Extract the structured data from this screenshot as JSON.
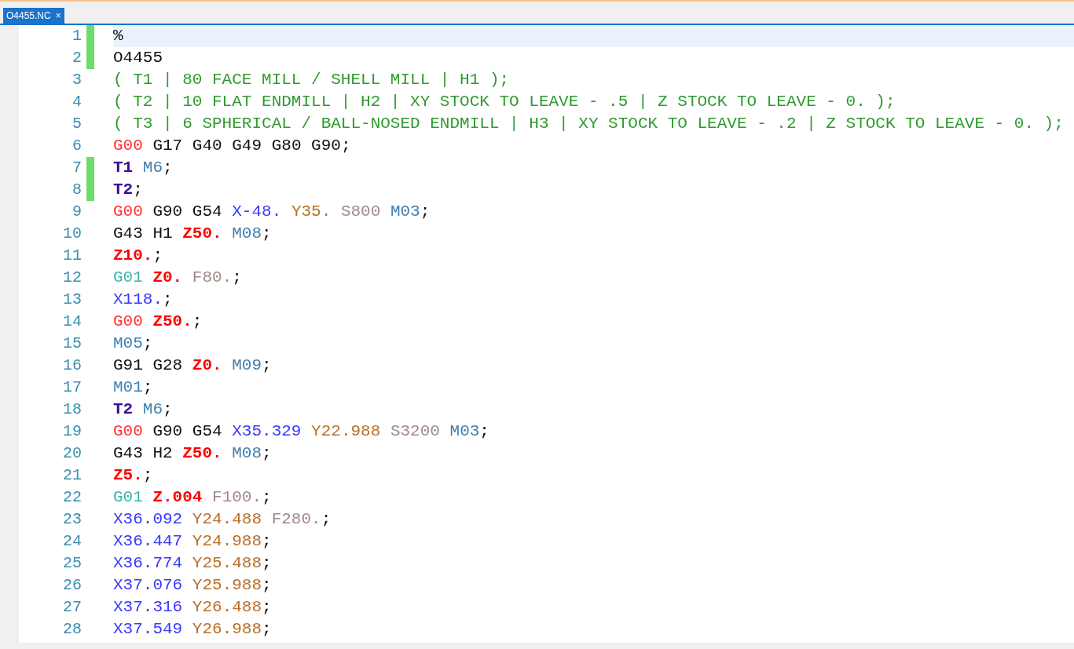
{
  "tabs": [
    {
      "label": "O4455.NC",
      "close": "×",
      "selected": true
    }
  ],
  "lines": [
    {
      "number": "1",
      "changed": true,
      "current": true,
      "tokens": [
        {
          "kind": "plain",
          "text": "%"
        }
      ]
    },
    {
      "number": "2",
      "changed": true,
      "current": false,
      "tokens": [
        {
          "kind": "plain",
          "text": "O4455"
        }
      ]
    },
    {
      "number": "3",
      "changed": false,
      "current": false,
      "tokens": [
        {
          "kind": "comment",
          "text": "( T1 | 80 FACE MILL / SHELL MILL | H1 );"
        }
      ]
    },
    {
      "number": "4",
      "changed": false,
      "current": false,
      "tokens": [
        {
          "kind": "comment",
          "text": "( T2 | 10 FLAT ENDMILL | H2 | XY STOCK TO LEAVE - .5 | Z STOCK TO LEAVE - 0. );"
        }
      ]
    },
    {
      "number": "5",
      "changed": false,
      "current": false,
      "tokens": [
        {
          "kind": "comment",
          "text": "( T3 | 6 SPHERICAL / BALL-NOSED ENDMILL | H3 | XY STOCK TO LEAVE - .2 | Z STOCK TO LEAVE - 0. );"
        }
      ]
    },
    {
      "number": "6",
      "changed": false,
      "current": false,
      "tokens": [
        {
          "kind": "rapid",
          "text": "G00"
        },
        {
          "kind": "plain",
          "text": "G17"
        },
        {
          "kind": "plain",
          "text": "G40"
        },
        {
          "kind": "plain",
          "text": "G49"
        },
        {
          "kind": "plain",
          "text": "G80"
        },
        {
          "kind": "plain",
          "text": "G90"
        },
        {
          "kind": "punct",
          "text": ";"
        }
      ]
    },
    {
      "number": "7",
      "changed": true,
      "current": false,
      "tokens": [
        {
          "kind": "tool",
          "text": "T1"
        },
        {
          "kind": "mcode",
          "text": "M6"
        },
        {
          "kind": "punct",
          "text": ";"
        }
      ]
    },
    {
      "number": "8",
      "changed": true,
      "current": false,
      "tokens": [
        {
          "kind": "tool",
          "text": "T2"
        },
        {
          "kind": "punct",
          "text": ";"
        }
      ]
    },
    {
      "number": "9",
      "changed": false,
      "current": false,
      "tokens": [
        {
          "kind": "rapid",
          "text": "G00"
        },
        {
          "kind": "plain",
          "text": "G90"
        },
        {
          "kind": "plain",
          "text": "G54"
        },
        {
          "kind": "x",
          "text": "X-48."
        },
        {
          "kind": "y",
          "text": "Y35."
        },
        {
          "kind": "speed",
          "text": "S800"
        },
        {
          "kind": "mcode",
          "text": "M03"
        },
        {
          "kind": "punct",
          "text": ";"
        }
      ]
    },
    {
      "number": "10",
      "changed": false,
      "current": false,
      "tokens": [
        {
          "kind": "plain",
          "text": "G43"
        },
        {
          "kind": "plain",
          "text": "H1"
        },
        {
          "kind": "z",
          "text": "Z50."
        },
        {
          "kind": "mcode",
          "text": "M08"
        },
        {
          "kind": "punct",
          "text": ";"
        }
      ]
    },
    {
      "number": "11",
      "changed": false,
      "current": false,
      "tokens": [
        {
          "kind": "z",
          "text": "Z10."
        },
        {
          "kind": "punct",
          "text": ";"
        }
      ]
    },
    {
      "number": "12",
      "changed": false,
      "current": false,
      "tokens": [
        {
          "kind": "linear",
          "text": "G01"
        },
        {
          "kind": "z",
          "text": "Z0."
        },
        {
          "kind": "feed",
          "text": "F80."
        },
        {
          "kind": "punct",
          "text": ";"
        }
      ]
    },
    {
      "number": "13",
      "changed": false,
      "current": false,
      "tokens": [
        {
          "kind": "x",
          "text": "X118."
        },
        {
          "kind": "punct",
          "text": ";"
        }
      ]
    },
    {
      "number": "14",
      "changed": false,
      "current": false,
      "tokens": [
        {
          "kind": "rapid",
          "text": "G00"
        },
        {
          "kind": "z",
          "text": "Z50."
        },
        {
          "kind": "punct",
          "text": ";"
        }
      ]
    },
    {
      "number": "15",
      "changed": false,
      "current": false,
      "tokens": [
        {
          "kind": "mcode",
          "text": "M05"
        },
        {
          "kind": "punct",
          "text": ";"
        }
      ]
    },
    {
      "number": "16",
      "changed": false,
      "current": false,
      "tokens": [
        {
          "kind": "plain",
          "text": "G91"
        },
        {
          "kind": "plain",
          "text": "G28"
        },
        {
          "kind": "z",
          "text": "Z0."
        },
        {
          "kind": "mcode",
          "text": "M09"
        },
        {
          "kind": "punct",
          "text": ";"
        }
      ]
    },
    {
      "number": "17",
      "changed": false,
      "current": false,
      "tokens": [
        {
          "kind": "mcode",
          "text": "M01"
        },
        {
          "kind": "punct",
          "text": ";"
        }
      ]
    },
    {
      "number": "18",
      "changed": false,
      "current": false,
      "tokens": [
        {
          "kind": "tool",
          "text": "T2"
        },
        {
          "kind": "mcode",
          "text": "M6"
        },
        {
          "kind": "punct",
          "text": ";"
        }
      ]
    },
    {
      "number": "19",
      "changed": false,
      "current": false,
      "tokens": [
        {
          "kind": "rapid",
          "text": "G00"
        },
        {
          "kind": "plain",
          "text": "G90"
        },
        {
          "kind": "plain",
          "text": "G54"
        },
        {
          "kind": "x",
          "text": "X35.329"
        },
        {
          "kind": "y",
          "text": "Y22.988"
        },
        {
          "kind": "speed",
          "text": "S3200"
        },
        {
          "kind": "mcode",
          "text": "M03"
        },
        {
          "kind": "punct",
          "text": ";"
        }
      ]
    },
    {
      "number": "20",
      "changed": false,
      "current": false,
      "tokens": [
        {
          "kind": "plain",
          "text": "G43"
        },
        {
          "kind": "plain",
          "text": "H2"
        },
        {
          "kind": "z",
          "text": "Z50."
        },
        {
          "kind": "mcode",
          "text": "M08"
        },
        {
          "kind": "punct",
          "text": ";"
        }
      ]
    },
    {
      "number": "21",
      "changed": false,
      "current": false,
      "tokens": [
        {
          "kind": "z",
          "text": "Z5."
        },
        {
          "kind": "punct",
          "text": ";"
        }
      ]
    },
    {
      "number": "22",
      "changed": false,
      "current": false,
      "tokens": [
        {
          "kind": "linear",
          "text": "G01"
        },
        {
          "kind": "z",
          "text": "Z.004"
        },
        {
          "kind": "feed",
          "text": "F100."
        },
        {
          "kind": "punct",
          "text": ";"
        }
      ]
    },
    {
      "number": "23",
      "changed": false,
      "current": false,
      "tokens": [
        {
          "kind": "x",
          "text": "X36.092"
        },
        {
          "kind": "y",
          "text": "Y24.488"
        },
        {
          "kind": "feed",
          "text": "F280."
        },
        {
          "kind": "punct",
          "text": ";"
        }
      ]
    },
    {
      "number": "24",
      "changed": false,
      "current": false,
      "tokens": [
        {
          "kind": "x",
          "text": "X36.447"
        },
        {
          "kind": "y",
          "text": "Y24.988"
        },
        {
          "kind": "punct",
          "text": ";"
        }
      ]
    },
    {
      "number": "25",
      "changed": false,
      "current": false,
      "tokens": [
        {
          "kind": "x",
          "text": "X36.774"
        },
        {
          "kind": "y",
          "text": "Y25.488"
        },
        {
          "kind": "punct",
          "text": ";"
        }
      ]
    },
    {
      "number": "26",
      "changed": false,
      "current": false,
      "tokens": [
        {
          "kind": "x",
          "text": "X37.076"
        },
        {
          "kind": "y",
          "text": "Y25.988"
        },
        {
          "kind": "punct",
          "text": ";"
        }
      ]
    },
    {
      "number": "27",
      "changed": false,
      "current": false,
      "tokens": [
        {
          "kind": "x",
          "text": "X37.316"
        },
        {
          "kind": "y",
          "text": "Y26.488"
        },
        {
          "kind": "punct",
          "text": ";"
        }
      ]
    },
    {
      "number": "28",
      "changed": false,
      "current": false,
      "tokens": [
        {
          "kind": "x",
          "text": "X37.549"
        },
        {
          "kind": "y",
          "text": "Y26.988"
        },
        {
          "kind": "punct",
          "text": ";"
        }
      ]
    }
  ]
}
